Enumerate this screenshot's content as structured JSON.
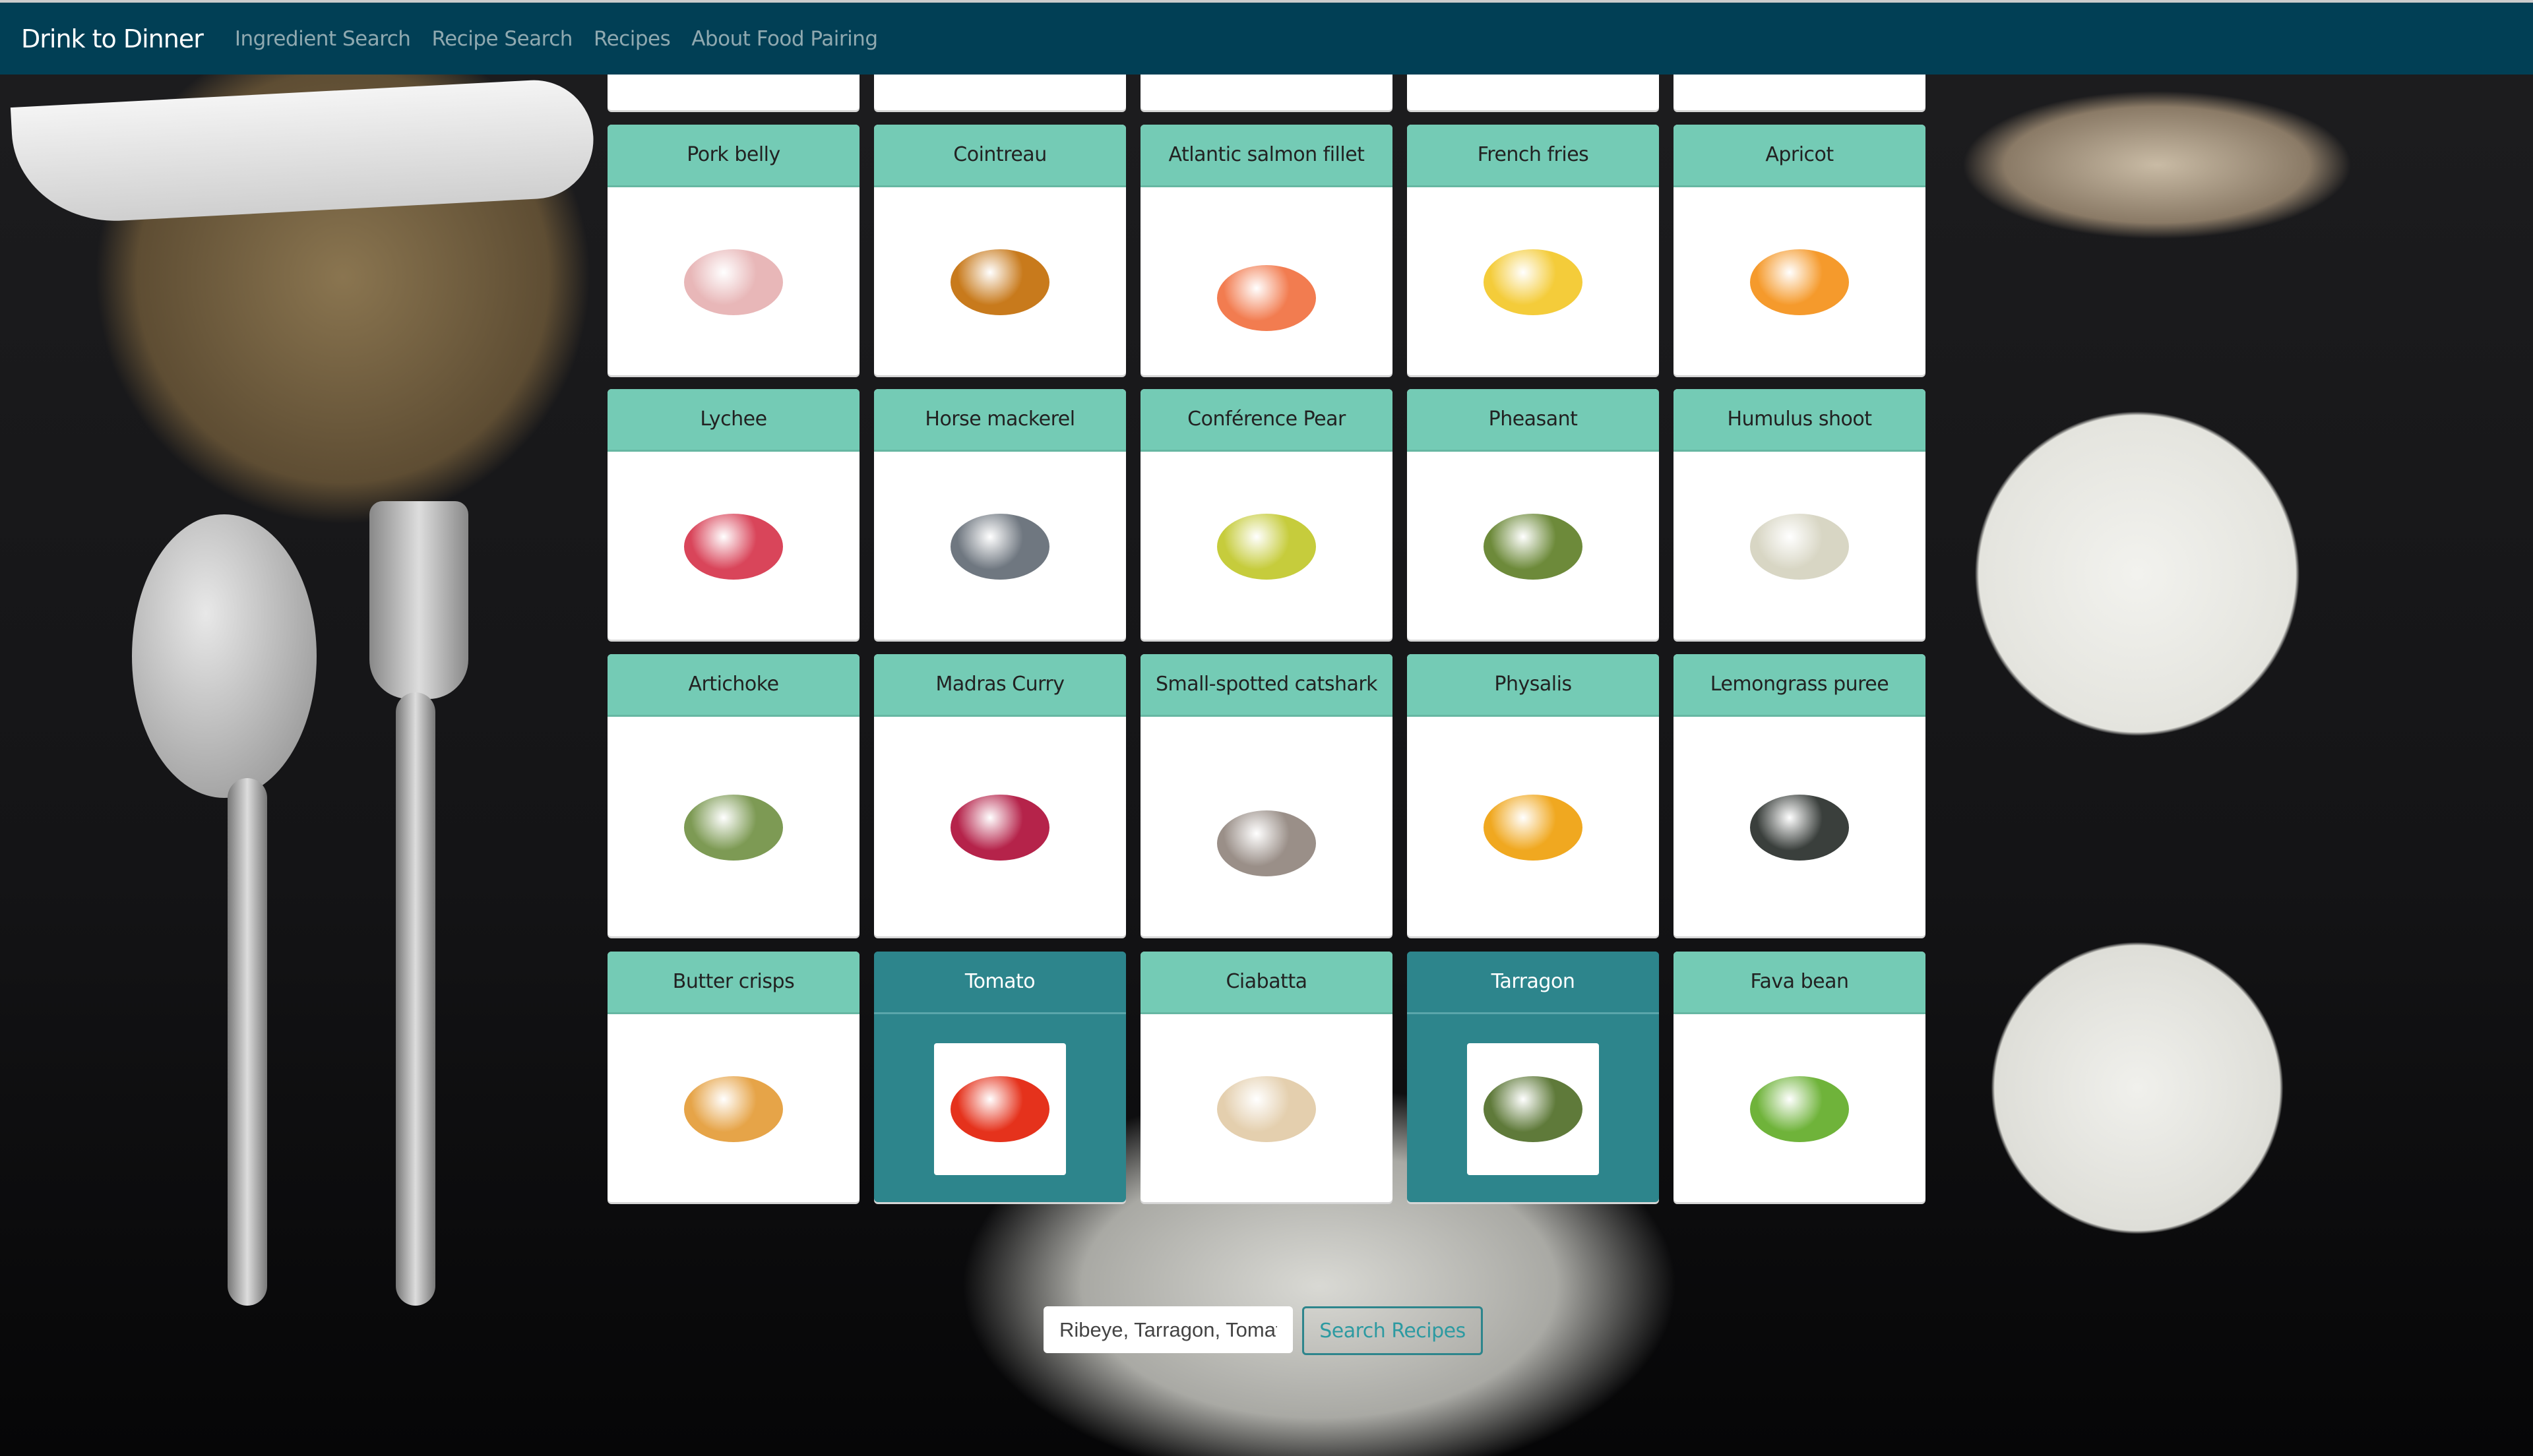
{
  "navbar": {
    "brand": "Drink to Dinner",
    "links": [
      "Ingredient Search",
      "Recipe Search",
      "Recipes",
      "About Food Pairing"
    ]
  },
  "ingredients": [
    {
      "name": "",
      "selected": false,
      "icon": "partial-card",
      "color": "#ffffff"
    },
    {
      "name": "",
      "selected": false,
      "icon": "partial-card",
      "color": "#ffffff"
    },
    {
      "name": "",
      "selected": false,
      "icon": "partial-card",
      "color": "#ffffff"
    },
    {
      "name": "",
      "selected": false,
      "icon": "partial-card",
      "color": "#ffffff"
    },
    {
      "name": "",
      "selected": false,
      "icon": "partial-card",
      "color": "#ffffff"
    },
    {
      "name": "Pork belly",
      "selected": false,
      "icon": "pork-belly-image",
      "color": "#e8b7b8"
    },
    {
      "name": "Cointreau",
      "selected": false,
      "icon": "cointreau-bottle-image",
      "color": "#c87a1c"
    },
    {
      "name": "Atlantic salmon fillet",
      "selected": false,
      "icon": "salmon-image",
      "color": "#f27c50"
    },
    {
      "name": "French fries",
      "selected": false,
      "icon": "french-fries-image",
      "color": "#f4cc3a"
    },
    {
      "name": "Apricot",
      "selected": false,
      "icon": "apricot-image",
      "color": "#f59a2c"
    },
    {
      "name": "Lychee",
      "selected": false,
      "icon": "lychee-image",
      "color": "#d9455a"
    },
    {
      "name": "Horse mackerel",
      "selected": false,
      "icon": "mackerel-image",
      "color": "#6f7780"
    },
    {
      "name": "Conférence Pear",
      "selected": false,
      "icon": "pear-image",
      "color": "#c6cc3c"
    },
    {
      "name": "Pheasant",
      "selected": false,
      "icon": "pheasant-image",
      "color": "#6d8a3a"
    },
    {
      "name": "Humulus shoot",
      "selected": false,
      "icon": "humulus-shoot-image",
      "color": "#d8d6c4"
    },
    {
      "name": "Artichoke",
      "selected": false,
      "icon": "artichoke-image",
      "color": "#7d9a54"
    },
    {
      "name": "Madras Curry",
      "selected": false,
      "icon": "madras-curry-tub-image",
      "color": "#b5234a"
    },
    {
      "name": "Small-spotted catshark",
      "selected": false,
      "icon": "catshark-image",
      "color": "#9a8f88"
    },
    {
      "name": "Physalis",
      "selected": false,
      "icon": "physalis-image",
      "color": "#f0a820"
    },
    {
      "name": "Lemongrass puree",
      "selected": false,
      "icon": "lemongrass-puree-tub-image",
      "color": "#3a3f3c"
    },
    {
      "name": "Butter crisps",
      "selected": false,
      "icon": "butter-crisps-image",
      "color": "#e6a448"
    },
    {
      "name": "Tomato",
      "selected": true,
      "icon": "tomato-image",
      "color": "#e5321c"
    },
    {
      "name": "Ciabatta",
      "selected": false,
      "icon": "ciabatta-image",
      "color": "#e4cfae"
    },
    {
      "name": "Tarragon",
      "selected": true,
      "icon": "tarragon-image",
      "color": "#5f7a3a"
    },
    {
      "name": "Fava bean",
      "selected": false,
      "icon": "fava-bean-image",
      "color": "#6fb33a"
    }
  ],
  "search": {
    "value": "Ribeye, Tarragon, Tomato",
    "button_label": "Search Recipes"
  },
  "colors": {
    "navbar": "#013f55",
    "card_header": "#74cbb5",
    "selected": "#2d858c"
  }
}
